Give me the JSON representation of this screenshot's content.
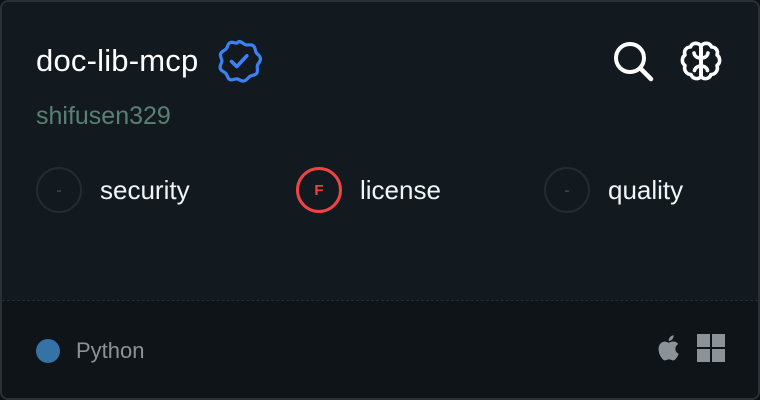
{
  "server": {
    "name": "doc-lib-mcp",
    "author": "shifusen329",
    "verified": true
  },
  "actions": {
    "search_icon": "search-icon",
    "brain_icon": "brain-icon"
  },
  "scores": [
    {
      "key": "security",
      "grade": "-",
      "label": "security",
      "status": "none"
    },
    {
      "key": "license",
      "grade": "F",
      "label": "license",
      "status": "fail"
    },
    {
      "key": "quality",
      "grade": "-",
      "label": "quality",
      "status": "none"
    }
  ],
  "footer": {
    "language": "Python",
    "language_color": "#3572a5",
    "platforms": [
      "apple-icon",
      "windows-icon"
    ]
  },
  "colors": {
    "accent_blue": "#3b82f6",
    "fail_red": "#ef4444",
    "author_green": "#5a8074"
  }
}
